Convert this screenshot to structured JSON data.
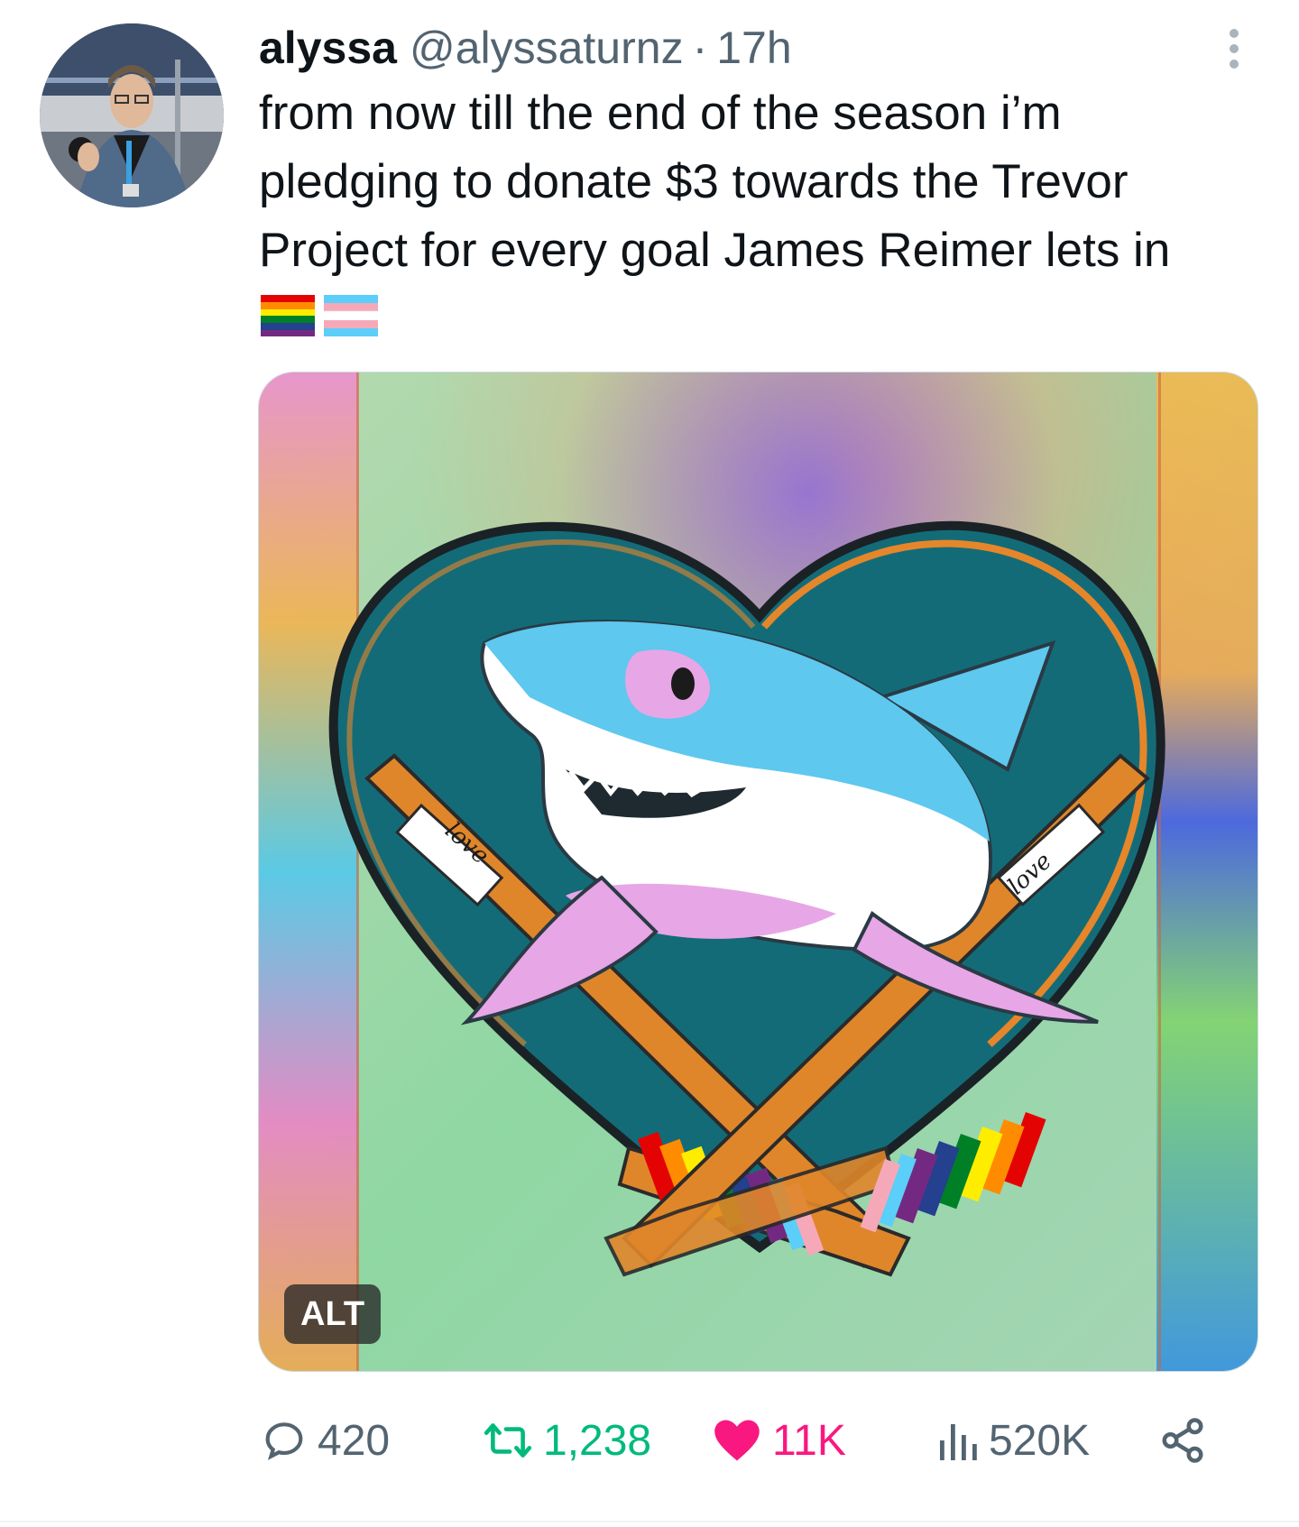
{
  "post": {
    "display_name": "alyssa",
    "handle": "@alyssaturnz",
    "separator": "·",
    "time": "17h",
    "text": "from now till the end of the season i’m pledging to donate $3 towards the Trevor Project for every goal James Reimer lets in",
    "emoji": [
      "rainbow-flag",
      "transgender-flag"
    ],
    "media": {
      "alt_label": "ALT",
      "stick_text_left": "love",
      "stick_text_right": "love"
    }
  },
  "actions": {
    "replies": "420",
    "reposts": "1,238",
    "likes": "11K",
    "views": "520K"
  },
  "colors": {
    "text": "#0f1419",
    "secondary": "#536471",
    "repost": "#00ba7c",
    "like": "#f91880"
  }
}
